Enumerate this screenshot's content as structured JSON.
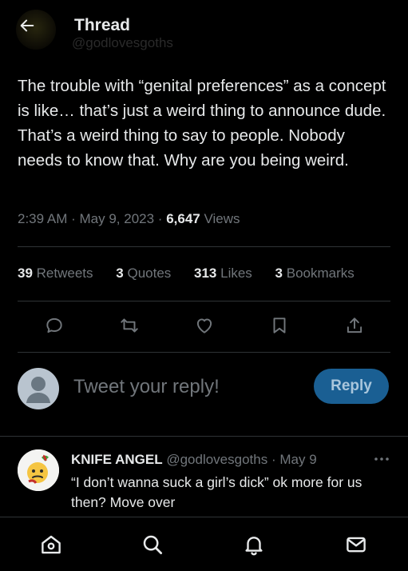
{
  "header": {
    "title": "Thread",
    "back_icon": "arrow-left-icon",
    "faded_handle": "@godlovesgoths"
  },
  "tweet": {
    "text": "The trouble with “genital preferences” as a concept is like… that’s just a weird thing to announce dude. That’s a weird thing to say to people. Nobody needs to know that. Why are you being weird.",
    "time": "2:39 AM",
    "date": "May 9, 2023",
    "views_count": "6,647",
    "views_label": "Views"
  },
  "stats": [
    {
      "count": "39",
      "label": "Retweets"
    },
    {
      "count": "3",
      "label": "Quotes"
    },
    {
      "count": "313",
      "label": "Likes"
    },
    {
      "count": "3",
      "label": "Bookmarks"
    }
  ],
  "actions": [
    "reply-icon",
    "retweet-icon",
    "like-icon",
    "bookmark-icon",
    "share-icon"
  ],
  "reply_box": {
    "placeholder": "Tweet your reply!",
    "button_label": "Reply"
  },
  "comment": {
    "name": "KNIFE ANGEL",
    "handle": "@godlovesgoths",
    "date": "May 9",
    "text": "“I don’t wanna suck a girl’s dick” ok more for us then? Move over"
  },
  "nav": [
    "home-icon",
    "search-icon",
    "notifications-icon",
    "messages-icon"
  ],
  "colors": {
    "background": "#000000",
    "text": "#e7e9ea",
    "muted": "#71767b",
    "divider": "#2f3336",
    "reply_button": "#1a5f93"
  }
}
